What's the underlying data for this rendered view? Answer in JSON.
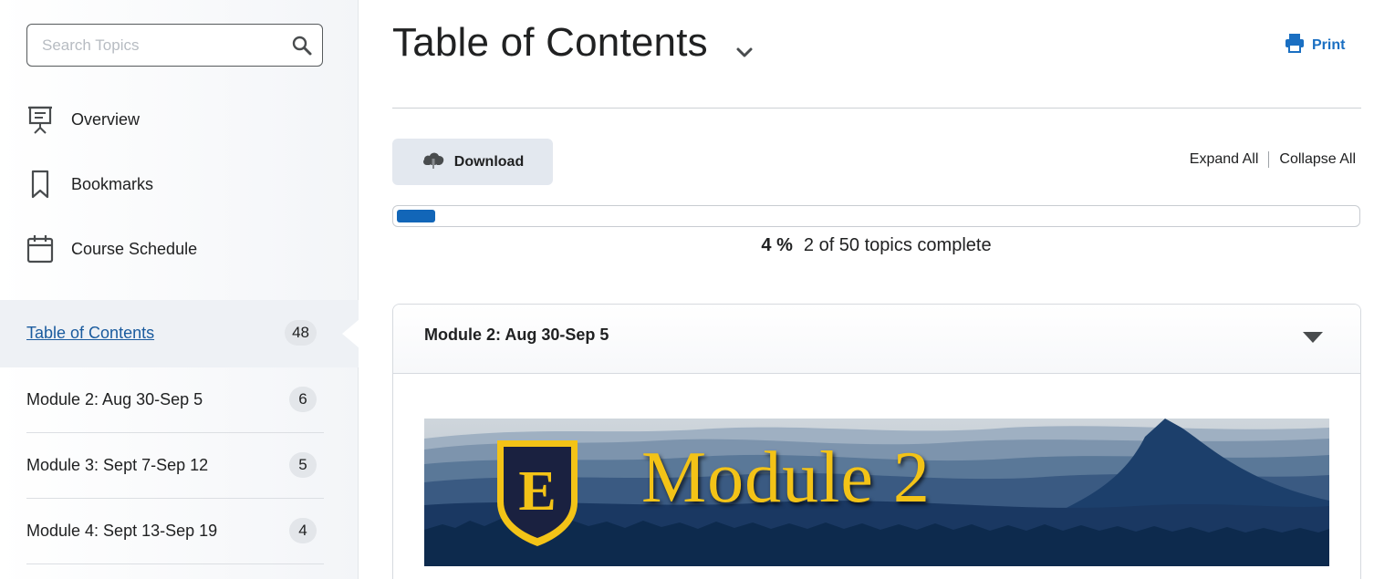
{
  "sidebar": {
    "search": {
      "placeholder": "Search Topics",
      "value": ""
    },
    "nav": [
      {
        "label": "Overview",
        "icon": "presentation-icon"
      },
      {
        "label": "Bookmarks",
        "icon": "bookmark-icon"
      },
      {
        "label": "Course Schedule",
        "icon": "calendar-icon"
      }
    ],
    "toc": {
      "label": "Table of Contents",
      "count": "48"
    },
    "modules": [
      {
        "label": "Module 2: Aug 30-Sep 5",
        "count": "6"
      },
      {
        "label": "Module 3: Sept 7-Sep 12",
        "count": "5"
      },
      {
        "label": "Module 4: Sept 13-Sep 19",
        "count": "4"
      }
    ]
  },
  "header": {
    "title": "Table of Contents",
    "print_label": "Print"
  },
  "toolbar": {
    "download_label": "Download",
    "expand_all": "Expand All",
    "collapse_all": "Collapse All"
  },
  "progress": {
    "percent_label": "4 %",
    "percent": 4,
    "summary": "2 of 50 topics complete"
  },
  "module": {
    "title": "Module 2: Aug 30-Sep 5",
    "banner_text": "Module 2",
    "banner_logo_letter": "E"
  },
  "colors": {
    "accent": "#1266b8",
    "link": "#1a5b9e",
    "banner_gold": "#f3c317",
    "banner_navy": "#0d2a4d"
  }
}
